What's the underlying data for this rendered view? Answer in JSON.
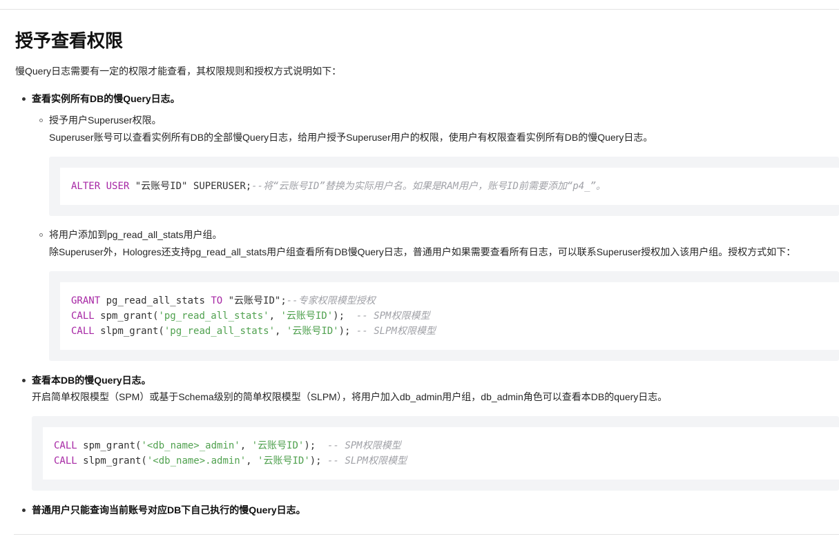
{
  "title": "授予查看权限",
  "intro": "慢Query日志需要有一定的权限才能查看，其权限规则和授权方式说明如下：",
  "section1": {
    "heading": "查看实例所有DB的慢Query日志。",
    "sub1": {
      "heading": "授予用户Superuser权限。",
      "body": "Superuser账号可以查看实例所有DB的全部慢Query日志，给用户授予Superuser用户的权限，使用户有权限查看实例所有DB的慢Query日志。",
      "code": {
        "l1_kw1": "ALTER",
        "l1_kw2": "USER",
        "l1_rest": " \"云账号ID\" SUPERUSER;",
        "l1_comment": "--将“云账号ID”替换为实际用户名。如果是RAM用户，账号ID前需要添加“p4_”。"
      }
    },
    "sub2": {
      "heading": "将用户添加到pg_read_all_stats用户组。",
      "body": "除Superuser外，Hologres还支持pg_read_all_stats用户组查看所有DB慢Query日志，普通用户如果需要查看所有日志，可以联系Superuser授权加入该用户组。授权方式如下：",
      "code": {
        "l1_kw1": "GRANT",
        "l1_mid": " pg_read_all_stats ",
        "l1_kw2": "TO",
        "l1_rest": " \"云账号ID\";",
        "l1_comment": "--专家权限模型授权",
        "l2_kw": "CALL",
        "l2_fn": " spm_grant(",
        "l2_s1": "'pg_read_all_stats'",
        "l2_sep": ", ",
        "l2_s2": "'云账号ID'",
        "l2_end": ");  ",
        "l2_comment": "-- SPM权限模型",
        "l3_kw": "CALL",
        "l3_fn": " slpm_grant(",
        "l3_s1": "'pg_read_all_stats'",
        "l3_sep": ", ",
        "l3_s2": "'云账号ID'",
        "l3_end": "); ",
        "l3_comment": "-- SLPM权限模型"
      }
    }
  },
  "section2": {
    "heading": "查看本DB的慢Query日志。",
    "body": "开启简单权限模型（SPM）或基于Schema级别的简单权限模型（SLPM），将用户加入db_admin用户组，db_admin角色可以查看本DB的query日志。",
    "code": {
      "l1_kw": "CALL",
      "l1_fn": " spm_grant(",
      "l1_s1": "'<db_name>_admin'",
      "l1_sep": ", ",
      "l1_s2": "'云账号ID'",
      "l1_end": ");  ",
      "l1_comment": "-- SPM权限模型",
      "l2_kw": "CALL",
      "l2_fn": " slpm_grant(",
      "l2_s1": "'<db_name>.admin'",
      "l2_sep": ", ",
      "l2_s2": "'云账号ID'",
      "l2_end": "); ",
      "l2_comment": "-- SLPM权限模型"
    }
  },
  "section3": {
    "heading": "普通用户只能查询当前账号对应DB下自己执行的慢Query日志。"
  },
  "colors": {
    "keyword": "#a626a4",
    "string": "#50a14f",
    "comment": "#a0a1a7",
    "code_background": "#f3f4f6"
  }
}
